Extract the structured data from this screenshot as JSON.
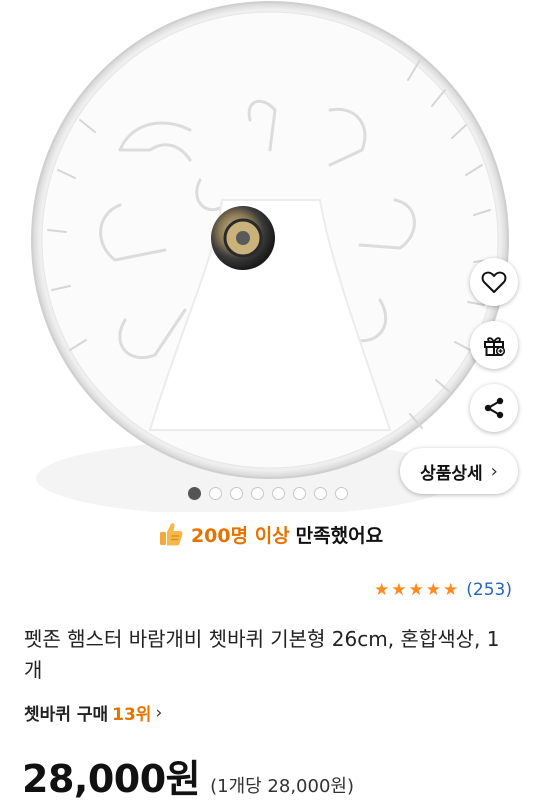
{
  "hero": {
    "image_alt": "hamster wheel product photo",
    "carousel": {
      "count": 8,
      "active_index": 0
    }
  },
  "actions": {
    "wishlist_icon": "heart-icon",
    "gift_icon": "gift-icon",
    "share_icon": "share-icon",
    "detail_label": "상품상세"
  },
  "satisfaction": {
    "icon": "thumbs-up-icon",
    "highlight": "200명 이상",
    "rest": "만족했어요"
  },
  "rating": {
    "stars": 5,
    "count": "(253)"
  },
  "product": {
    "title": "펫존 햄스터 바람개비 쳇바퀴 기본형 26cm, 혼합색상, 1개",
    "rank_prefix": "쳇바퀴 구매",
    "rank_value": "13위",
    "price": "28,000원",
    "unit_price": "(1개당 28,000원)"
  },
  "colors": {
    "accent_orange": "#e67300",
    "star": "#ff8a1f",
    "link_blue": "#2463c4"
  }
}
